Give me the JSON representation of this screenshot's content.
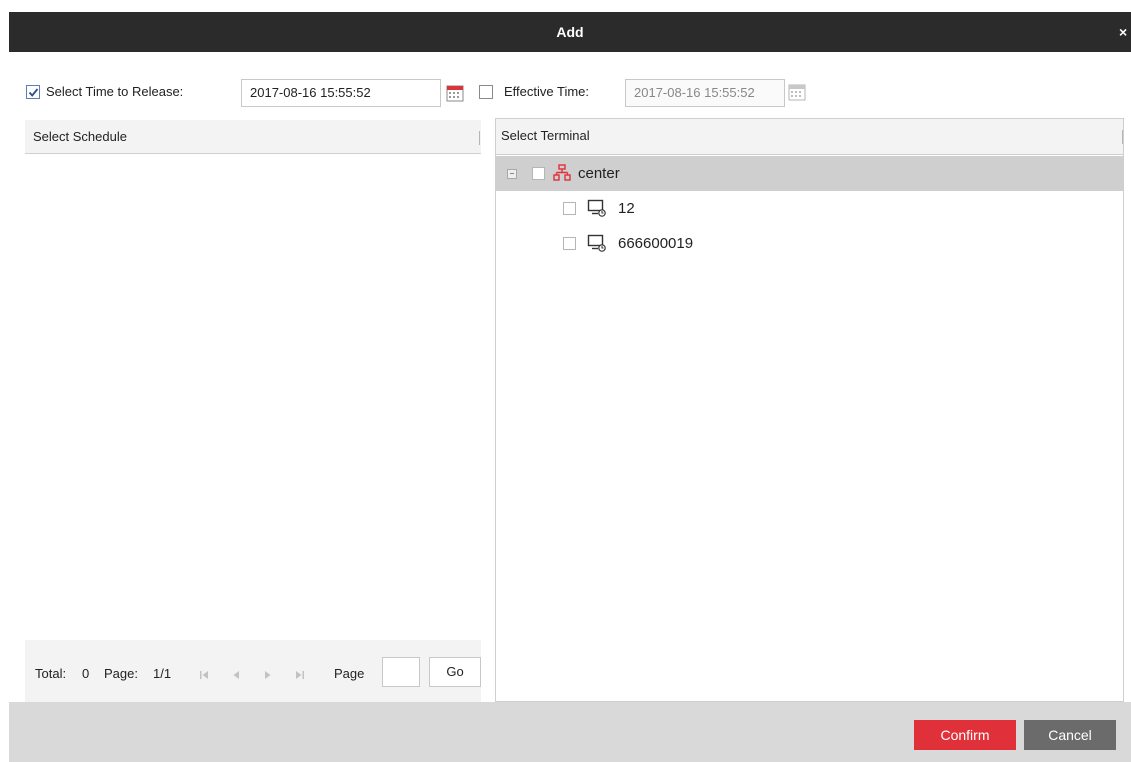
{
  "dialog": {
    "title": "Add",
    "close_label": "×"
  },
  "release": {
    "checked": true,
    "label": "Select Time to Release:",
    "value": "2017-08-16 15:55:52"
  },
  "effective": {
    "checked": false,
    "label": "Effective Time:",
    "value": "2017-08-16 15:55:52"
  },
  "schedule_panel": {
    "header": "Select Schedule",
    "pager": {
      "total_label": "Total:",
      "total_value": "0",
      "page_label": "Page:",
      "page_value": "1/1",
      "goto_label": "Page",
      "goto_value": "",
      "go_label": "Go"
    }
  },
  "terminal_panel": {
    "header": "Select Terminal",
    "tree": {
      "root": {
        "label": "center",
        "expanded": true,
        "checked": false,
        "icon": "org-tree-icon"
      },
      "children": [
        {
          "label": "12",
          "checked": false,
          "icon": "terminal-icon"
        },
        {
          "label": "666600019",
          "checked": false,
          "icon": "terminal-icon"
        }
      ]
    }
  },
  "footer": {
    "confirm_label": "Confirm",
    "cancel_label": "Cancel"
  },
  "colors": {
    "titlebar": "#2b2b2b",
    "confirm": "#e0303a",
    "cancel": "#6b6b6b",
    "org_icon": "#e0303a",
    "selected_row": "#cfcfcf"
  }
}
